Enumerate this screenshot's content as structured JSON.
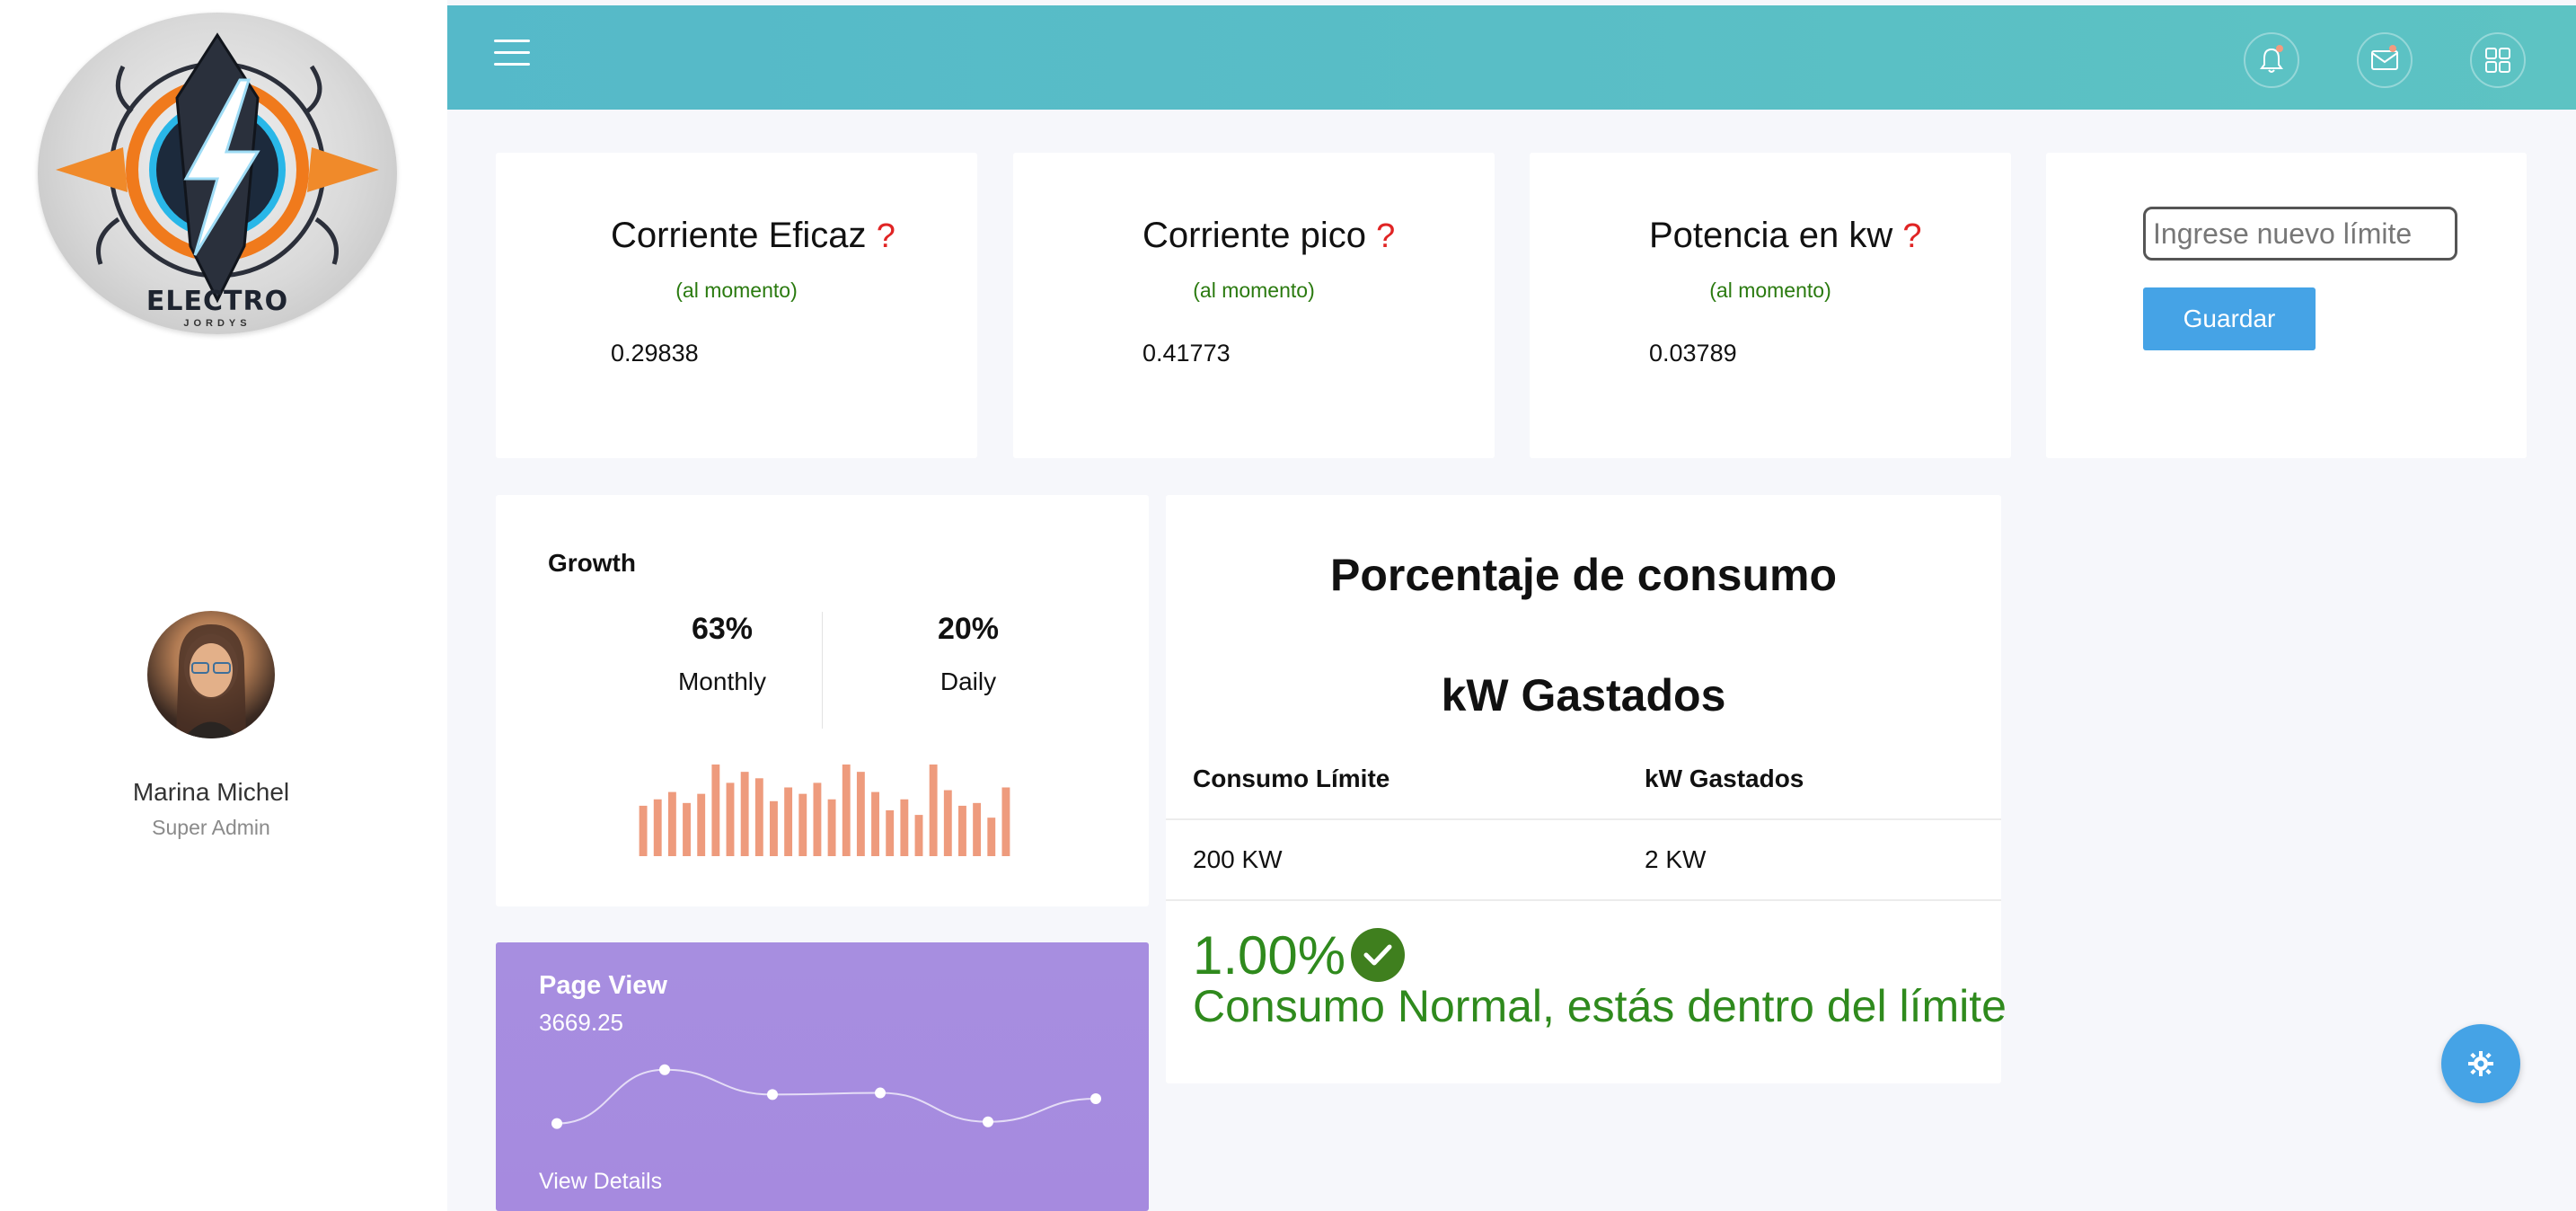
{
  "brand": {
    "logo_text": "ELECTRO",
    "logo_subtext": "JORDYS"
  },
  "user": {
    "name": "Marina Michel",
    "role": "Super Admin"
  },
  "header": {
    "icons": [
      "menu-icon",
      "bell-icon",
      "mail-icon",
      "grid-icon"
    ]
  },
  "metrics": [
    {
      "title": "Corriente Eficaz",
      "help": "?",
      "subtitle": "(al momento)",
      "value": "0.29838"
    },
    {
      "title": "Corriente pico",
      "help": "?",
      "subtitle": "(al momento)",
      "value": "0.41773"
    },
    {
      "title": "Potencia en kw",
      "help": "?",
      "subtitle": "(al momento)",
      "value": "0.03789"
    }
  ],
  "limit_form": {
    "placeholder": "Ingrese nuevo límite",
    "value": "",
    "button_label": "Guardar"
  },
  "growth": {
    "title": "Growth",
    "monthly_value": "63%",
    "monthly_label": "Monthly",
    "daily_value": "20%",
    "daily_label": "Daily",
    "bars": [
      0.55,
      0.62,
      0.7,
      0.58,
      0.68,
      1.0,
      0.8,
      0.92,
      0.85,
      0.6,
      0.75,
      0.68,
      0.8,
      0.62,
      1.0,
      0.92,
      0.7,
      0.5,
      0.62,
      0.45,
      1.0,
      0.72,
      0.55,
      0.58,
      0.42,
      0.75
    ],
    "bar_color": "#ee9b7d"
  },
  "page_view": {
    "title": "Page View",
    "value": "3669.25",
    "link": "View Details",
    "points": [
      0.2,
      0.85,
      0.55,
      0.57,
      0.22,
      0.5
    ]
  },
  "consumption": {
    "title": "Porcentaje de consumo",
    "subtitle": "kW Gastados",
    "col_limit": "Consumo Límite",
    "col_spent": "kW Gastados",
    "limit_value": "200 KW",
    "spent_value": "2 KW",
    "percentage": "1.00%",
    "status": "Consumo Normal, estás dentro del límite",
    "status_color": "#2f8a1d"
  },
  "colors": {
    "header": "#55b9c9",
    "accent": "#45a3e6",
    "page_view_bg": "#a78ee0"
  }
}
